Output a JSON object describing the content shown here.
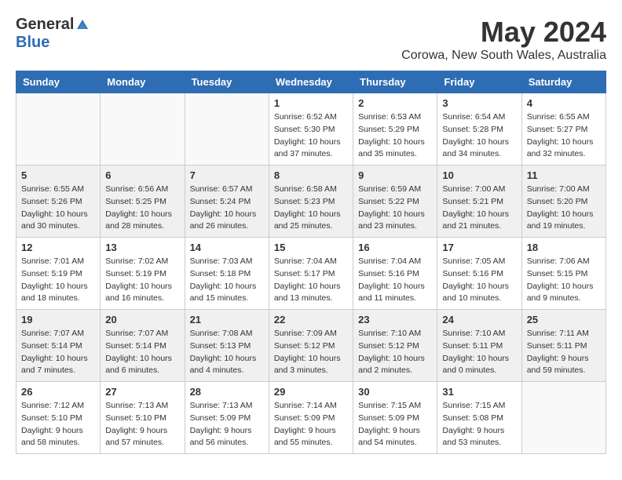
{
  "header": {
    "logo_general": "General",
    "logo_blue": "Blue",
    "month_title": "May 2024",
    "location": "Corowa, New South Wales, Australia"
  },
  "weekdays": [
    "Sunday",
    "Monday",
    "Tuesday",
    "Wednesday",
    "Thursday",
    "Friday",
    "Saturday"
  ],
  "weeks": [
    [
      {
        "day": "",
        "info": ""
      },
      {
        "day": "",
        "info": ""
      },
      {
        "day": "",
        "info": ""
      },
      {
        "day": "1",
        "info": "Sunrise: 6:52 AM\nSunset: 5:30 PM\nDaylight: 10 hours\nand 37 minutes."
      },
      {
        "day": "2",
        "info": "Sunrise: 6:53 AM\nSunset: 5:29 PM\nDaylight: 10 hours\nand 35 minutes."
      },
      {
        "day": "3",
        "info": "Sunrise: 6:54 AM\nSunset: 5:28 PM\nDaylight: 10 hours\nand 34 minutes."
      },
      {
        "day": "4",
        "info": "Sunrise: 6:55 AM\nSunset: 5:27 PM\nDaylight: 10 hours\nand 32 minutes."
      }
    ],
    [
      {
        "day": "5",
        "info": "Sunrise: 6:55 AM\nSunset: 5:26 PM\nDaylight: 10 hours\nand 30 minutes."
      },
      {
        "day": "6",
        "info": "Sunrise: 6:56 AM\nSunset: 5:25 PM\nDaylight: 10 hours\nand 28 minutes."
      },
      {
        "day": "7",
        "info": "Sunrise: 6:57 AM\nSunset: 5:24 PM\nDaylight: 10 hours\nand 26 minutes."
      },
      {
        "day": "8",
        "info": "Sunrise: 6:58 AM\nSunset: 5:23 PM\nDaylight: 10 hours\nand 25 minutes."
      },
      {
        "day": "9",
        "info": "Sunrise: 6:59 AM\nSunset: 5:22 PM\nDaylight: 10 hours\nand 23 minutes."
      },
      {
        "day": "10",
        "info": "Sunrise: 7:00 AM\nSunset: 5:21 PM\nDaylight: 10 hours\nand 21 minutes."
      },
      {
        "day": "11",
        "info": "Sunrise: 7:00 AM\nSunset: 5:20 PM\nDaylight: 10 hours\nand 19 minutes."
      }
    ],
    [
      {
        "day": "12",
        "info": "Sunrise: 7:01 AM\nSunset: 5:19 PM\nDaylight: 10 hours\nand 18 minutes."
      },
      {
        "day": "13",
        "info": "Sunrise: 7:02 AM\nSunset: 5:19 PM\nDaylight: 10 hours\nand 16 minutes."
      },
      {
        "day": "14",
        "info": "Sunrise: 7:03 AM\nSunset: 5:18 PM\nDaylight: 10 hours\nand 15 minutes."
      },
      {
        "day": "15",
        "info": "Sunrise: 7:04 AM\nSunset: 5:17 PM\nDaylight: 10 hours\nand 13 minutes."
      },
      {
        "day": "16",
        "info": "Sunrise: 7:04 AM\nSunset: 5:16 PM\nDaylight: 10 hours\nand 11 minutes."
      },
      {
        "day": "17",
        "info": "Sunrise: 7:05 AM\nSunset: 5:16 PM\nDaylight: 10 hours\nand 10 minutes."
      },
      {
        "day": "18",
        "info": "Sunrise: 7:06 AM\nSunset: 5:15 PM\nDaylight: 10 hours\nand 9 minutes."
      }
    ],
    [
      {
        "day": "19",
        "info": "Sunrise: 7:07 AM\nSunset: 5:14 PM\nDaylight: 10 hours\nand 7 minutes."
      },
      {
        "day": "20",
        "info": "Sunrise: 7:07 AM\nSunset: 5:14 PM\nDaylight: 10 hours\nand 6 minutes."
      },
      {
        "day": "21",
        "info": "Sunrise: 7:08 AM\nSunset: 5:13 PM\nDaylight: 10 hours\nand 4 minutes."
      },
      {
        "day": "22",
        "info": "Sunrise: 7:09 AM\nSunset: 5:12 PM\nDaylight: 10 hours\nand 3 minutes."
      },
      {
        "day": "23",
        "info": "Sunrise: 7:10 AM\nSunset: 5:12 PM\nDaylight: 10 hours\nand 2 minutes."
      },
      {
        "day": "24",
        "info": "Sunrise: 7:10 AM\nSunset: 5:11 PM\nDaylight: 10 hours\nand 0 minutes."
      },
      {
        "day": "25",
        "info": "Sunrise: 7:11 AM\nSunset: 5:11 PM\nDaylight: 9 hours\nand 59 minutes."
      }
    ],
    [
      {
        "day": "26",
        "info": "Sunrise: 7:12 AM\nSunset: 5:10 PM\nDaylight: 9 hours\nand 58 minutes."
      },
      {
        "day": "27",
        "info": "Sunrise: 7:13 AM\nSunset: 5:10 PM\nDaylight: 9 hours\nand 57 minutes."
      },
      {
        "day": "28",
        "info": "Sunrise: 7:13 AM\nSunset: 5:09 PM\nDaylight: 9 hours\nand 56 minutes."
      },
      {
        "day": "29",
        "info": "Sunrise: 7:14 AM\nSunset: 5:09 PM\nDaylight: 9 hours\nand 55 minutes."
      },
      {
        "day": "30",
        "info": "Sunrise: 7:15 AM\nSunset: 5:09 PM\nDaylight: 9 hours\nand 54 minutes."
      },
      {
        "day": "31",
        "info": "Sunrise: 7:15 AM\nSunset: 5:08 PM\nDaylight: 9 hours\nand 53 minutes."
      },
      {
        "day": "",
        "info": ""
      }
    ]
  ]
}
